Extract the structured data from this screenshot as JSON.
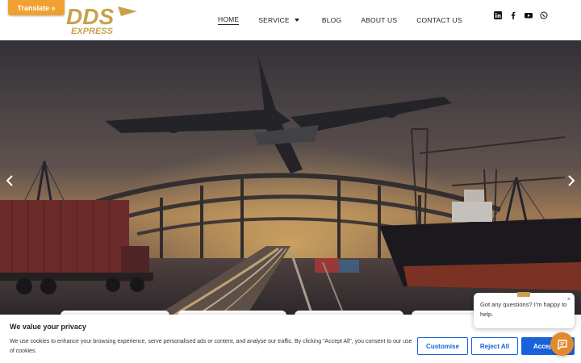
{
  "translate": {
    "label": "Translate »"
  },
  "brand": {
    "logo_main": "DDS",
    "logo_sub": "EXPRESS",
    "gold": "#c9a14a"
  },
  "nav": {
    "items": [
      {
        "label": "HOME",
        "active": true
      },
      {
        "label": "SERVICE",
        "dropdown": true
      },
      {
        "label": "BLOG"
      },
      {
        "label": "ABOUT US"
      },
      {
        "label": "CONTACT US"
      }
    ]
  },
  "socials": [
    {
      "icon": "linkedin-icon"
    },
    {
      "icon": "facebook-icon"
    },
    {
      "icon": "youtube-icon"
    },
    {
      "icon": "whatsapp-icon"
    }
  ],
  "hero": {
    "prev_icon": "chevron-left-icon",
    "next_icon": "chevron-right-icon"
  },
  "cookie": {
    "title": "We value your privacy",
    "text": "We use cookies to enhance your browsing experience, serve personalised ads or content, and analyse our traffic. By clicking \"Accept All\", you consent to our use of cookies.",
    "customise_label": "Customise",
    "reject_label": "Reject All",
    "accept_label": "Accept",
    "accent": "#1863dc"
  },
  "chat": {
    "message": "Got any questions? I'm happy to help.",
    "close_label": "×",
    "button_icon": "chat-icon",
    "button_color": "#e08a30"
  }
}
